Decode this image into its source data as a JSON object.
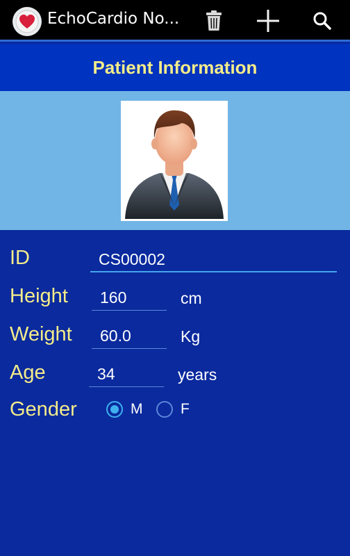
{
  "app": {
    "title": "EchoCardio No...",
    "icon": "heart-icon",
    "actions": [
      {
        "name": "delete",
        "icon": "trash-icon"
      },
      {
        "name": "add",
        "icon": "plus-icon"
      },
      {
        "name": "search",
        "icon": "search-icon"
      }
    ]
  },
  "header": {
    "title": "Patient Information"
  },
  "photo": {
    "icon": "patient-avatar"
  },
  "form": {
    "id": {
      "label": "ID",
      "value": "CS00002"
    },
    "height": {
      "label": "Height",
      "value": "160",
      "unit": "cm"
    },
    "weight": {
      "label": "Weight",
      "value": "60.0",
      "unit": "Kg"
    },
    "age": {
      "label": "Age",
      "value": "34",
      "unit": "years"
    },
    "gender": {
      "label": "Gender",
      "options": [
        {
          "label": "M",
          "selected": true
        },
        {
          "label": "F",
          "selected": false
        }
      ]
    }
  },
  "colors": {
    "action_bar": "#000000",
    "header": "#0033bf",
    "header_text": "#f4ec8a",
    "photo_band": "#71b5e6",
    "body": "#0a2a9e",
    "accent": "#3fb0ef"
  }
}
